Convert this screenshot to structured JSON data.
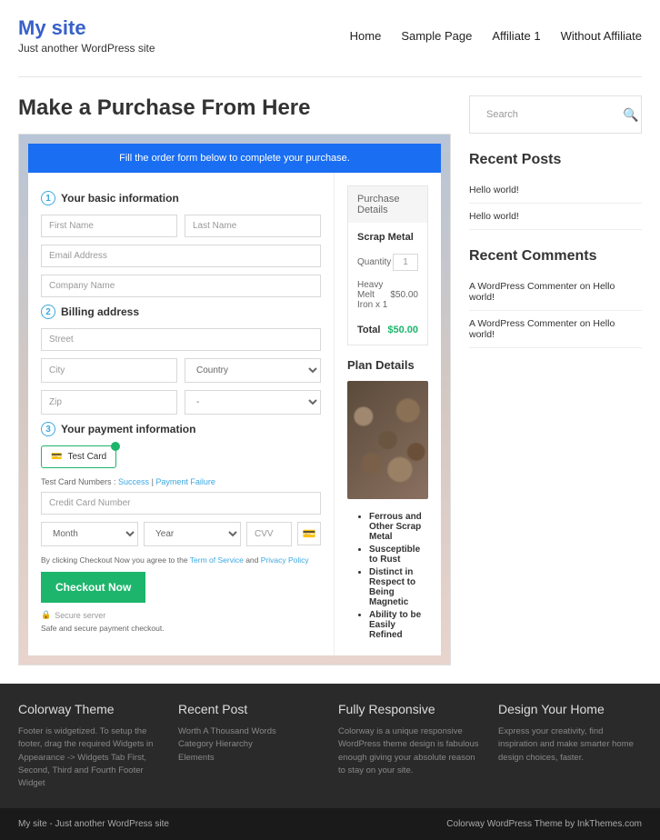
{
  "site": {
    "title": "My site",
    "tagline": "Just another WordPress site"
  },
  "nav": [
    "Home",
    "Sample Page",
    "Affiliate 1",
    "Without Affiliate"
  ],
  "page_title": "Make a Purchase From Here",
  "banner": "Fill the order form below to complete your purchase.",
  "form": {
    "s1": "Your basic information",
    "s2": "Billing address",
    "s3": "Your payment information",
    "first": "First Name",
    "last": "Last Name",
    "email": "Email Address",
    "company": "Company Name",
    "street": "Street",
    "city": "City",
    "country": "Country",
    "zip": "Zip",
    "state": "-",
    "test_card": "Test Card",
    "tcn_label": "Test Card Numbers :",
    "tcn_success": "Success",
    "tcn_sep": " | ",
    "tcn_fail": "Payment Failure",
    "cc": "Credit Card Number",
    "month": "Month",
    "year": "Year",
    "cvv": "CVV",
    "terms_pre": "By clicking Checkout Now you agree to the ",
    "terms_tos": "Term of Service",
    "terms_and": " and ",
    "terms_pp": "Privacy Policy",
    "checkout": "Checkout Now",
    "secure": "Secure server",
    "safe": "Safe and secure payment checkout."
  },
  "purchase": {
    "header": "Purchase Details",
    "product": "Scrap Metal",
    "qty_label": "Quantity",
    "qty": "1",
    "line_item": "Heavy Melt Iron x 1",
    "line_price": "$50.00",
    "total_label": "Total",
    "total": "$50.00",
    "plan_h": "Plan Details",
    "bullets": [
      "Ferrous and Other Scrap Metal",
      "Susceptible to Rust",
      "Distinct in Respect to Being Magnetic",
      "Ability to be Easily Refined"
    ]
  },
  "sidebar": {
    "search": "Search",
    "recent_posts_h": "Recent Posts",
    "recent_posts": [
      "Hello world!",
      "Hello world!"
    ],
    "recent_comments_h": "Recent Comments",
    "recent_comments": [
      "A WordPress Commenter on Hello world!",
      "A WordPress Commenter on Hello world!"
    ]
  },
  "footer": {
    "cols": [
      {
        "h": "Colorway Theme",
        "t": "Footer is widgetized. To setup the footer, drag the required Widgets in Appearance -> Widgets Tab First, Second, Third and Fourth Footer Widget"
      },
      {
        "h": "Recent Post",
        "t": "Worth A Thousand Words\nCategory Hierarchy\nElements"
      },
      {
        "h": "Fully Responsive",
        "t": "Colorway is a unique responsive WordPress theme design is fabulous enough giving your absolute reason to stay on your site."
      },
      {
        "h": "Design Your Home",
        "t": "Express your creativity, find inspiration and make smarter home design choices, faster."
      }
    ],
    "bl": "My site - Just another WordPress site",
    "br": "Colorway WordPress Theme by InkThemes.com"
  }
}
